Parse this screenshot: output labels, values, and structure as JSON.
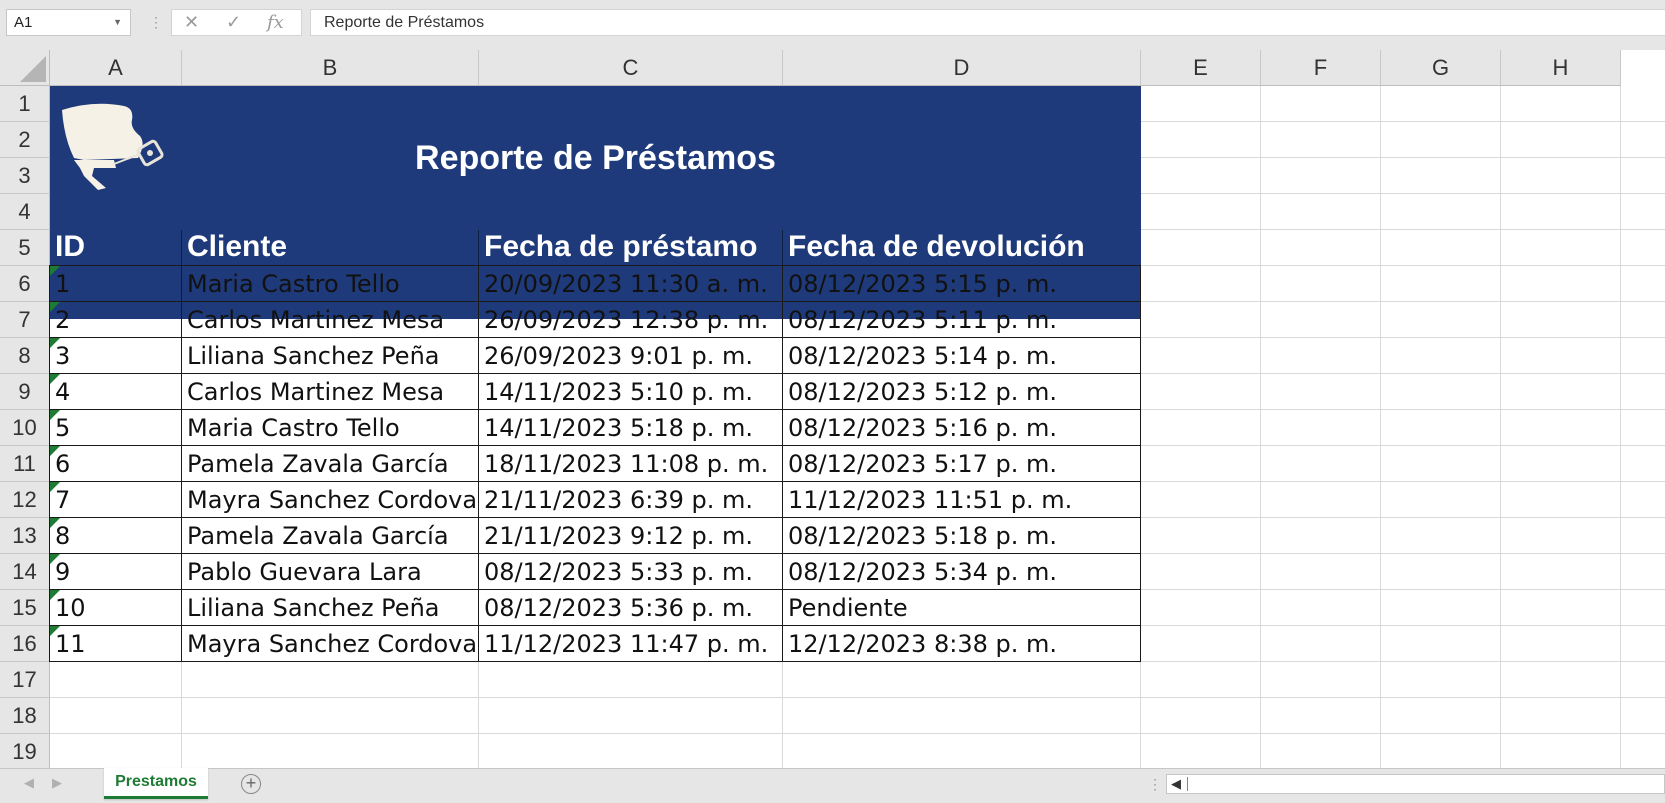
{
  "formula_bar": {
    "name_box": "A1",
    "formula": "Reporte de Préstamos",
    "cancel_icon": "close-icon",
    "enter_icon": "check-icon",
    "fx_label": "fx"
  },
  "columns": [
    "A",
    "B",
    "C",
    "D",
    "E",
    "F",
    "G",
    "H"
  ],
  "rows": [
    "1",
    "2",
    "3",
    "4",
    "5",
    "6",
    "7",
    "8",
    "9",
    "10",
    "11",
    "12",
    "13",
    "14",
    "15",
    "16",
    "17",
    "18",
    "19"
  ],
  "report": {
    "title": "Reporte de Préstamos",
    "headers": [
      "ID",
      "Cliente",
      "Fecha de préstamo",
      "Fecha de devolución"
    ],
    "header_color": "#1f3a7a",
    "records": [
      [
        "1",
        "Maria Castro Tello",
        "20/09/2023 11:30 a. m.",
        "08/12/2023 5:15 p. m."
      ],
      [
        "2",
        "Carlos Martinez Mesa",
        "26/09/2023 12:38 p. m.",
        "08/12/2023 5:11 p. m."
      ],
      [
        "3",
        "Liliana Sanchez Peña",
        "26/09/2023 9:01 p. m.",
        "08/12/2023 5:14 p. m."
      ],
      [
        "4",
        "Carlos Martinez Mesa",
        "14/11/2023 5:10 p. m.",
        "08/12/2023 5:12 p. m."
      ],
      [
        "5",
        "Maria Castro Tello",
        "14/11/2023 5:18 p. m.",
        "08/12/2023 5:16 p. m."
      ],
      [
        "6",
        "Pamela Zavala García",
        "18/11/2023 11:08 p. m.",
        "08/12/2023 5:17 p. m."
      ],
      [
        "7",
        "Mayra Sanchez Cordova",
        "21/11/2023 6:39 p. m.",
        "11/12/2023 11:51 p. m."
      ],
      [
        "8",
        "Pamela Zavala García",
        "21/11/2023 9:12 p. m.",
        "08/12/2023 5:18 p. m."
      ],
      [
        "9",
        "Pablo Guevara Lara",
        "08/12/2023 5:33 p. m.",
        "08/12/2023 5:34 p. m."
      ],
      [
        "10",
        "Liliana Sanchez Peña",
        "08/12/2023 5:36 p. m.",
        "Pendiente"
      ],
      [
        "11",
        "Mayra Sanchez Cordova",
        "11/12/2023 11:47 p. m.",
        "12/12/2023 8:38 p. m."
      ]
    ]
  },
  "sheet_tabs": {
    "active": "Prestamos",
    "add_icon": "plus-circle-icon"
  },
  "colors": {
    "accent": "#1e7b34"
  }
}
